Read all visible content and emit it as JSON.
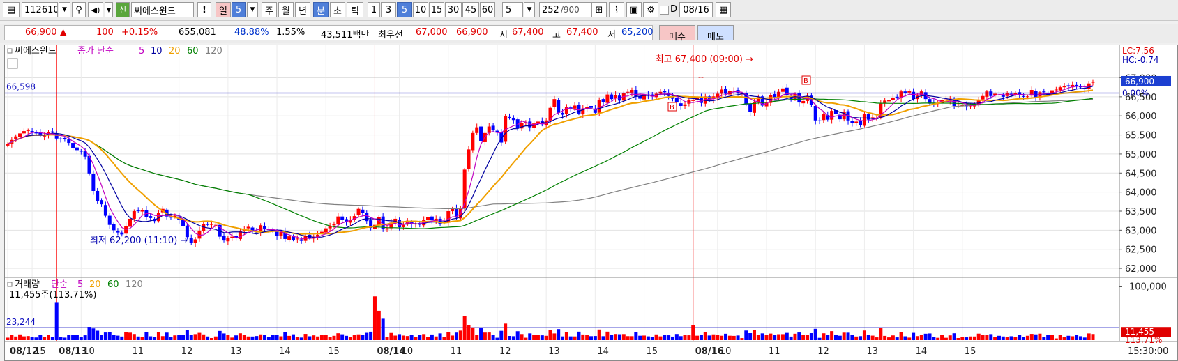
{
  "toolbar": {
    "code": "112610",
    "badge": "신",
    "name": "씨에스윈드",
    "exclaim": "!",
    "period_day": "일",
    "period_num": "5",
    "week": "주",
    "month": "월",
    "year": "년",
    "minute": "분",
    "second": "초",
    "tick": "틱",
    "intervals": [
      "1",
      "3",
      "5",
      "10",
      "15",
      "30",
      "45",
      "60"
    ],
    "selected_interval": "5",
    "interval_value": "5",
    "count": "252",
    "count_max": "/900",
    "d_label": "D",
    "date": "08/16"
  },
  "quote": {
    "price": "66,900 ▲",
    "change": "100",
    "change_pct": "+0.15%",
    "volume": "655,081",
    "vol_ratio": "48.88%",
    "turnover_pct": "1.55%",
    "amount": "43,511백만",
    "best_label": "최우선",
    "ask": "67,000",
    "bid": "66,900",
    "open_label": "시",
    "open": "67,400",
    "high_label": "고",
    "high": "67,400",
    "low_label": "저",
    "low": "65,200",
    "buy": "매수",
    "sell": "매도"
  },
  "colors": {
    "up": "#ff0000",
    "down": "#0000ff",
    "ma5": "#c000c0",
    "ma10": "#0000a0",
    "ma20": "#f0a000",
    "ma60": "#008000",
    "ma120": "#808080",
    "hline": "#1010c0",
    "vline": "#ff0000"
  },
  "legend": {
    "price": {
      "name": "씨에스윈드",
      "kind": "종가 단순",
      "ma": [
        "5",
        "10",
        "20",
        "60",
        "120"
      ]
    },
    "volume": {
      "name": "거래량",
      "kind": "단순",
      "ma": [
        "5",
        "20",
        "60",
        "120"
      ]
    }
  },
  "labels": {
    "hline_price": "66,598",
    "hline_volume": "23,244",
    "volume_info": "11,455주(113.71%)",
    "high_note": "최고 67,400 (09:00) →",
    "low_note": "최저 62,200 (11:10) →",
    "lc": "LC:7.56",
    "hc": "HC:-0.74",
    "price_box": "66,900",
    "pct_box": "0.00%",
    "vol_box": "11,455",
    "vol_pct_box": "113.71%",
    "vol_tick": "100,000",
    "time_corner": "15:30:00",
    "b_marker": "B",
    "dash": "--"
  },
  "x_axis": [
    {
      "label": "08/12",
      "bold": true
    },
    {
      "label": "15"
    },
    {
      "label": "08/13",
      "bold": true
    },
    {
      "label": "10"
    },
    {
      "label": "11"
    },
    {
      "label": "12"
    },
    {
      "label": "13"
    },
    {
      "label": "14"
    },
    {
      "label": "15"
    },
    {
      "label": "08/14",
      "bold": true
    },
    {
      "label": "10"
    },
    {
      "label": "11"
    },
    {
      "label": "12"
    },
    {
      "label": "13"
    },
    {
      "label": "14"
    },
    {
      "label": "15"
    },
    {
      "label": "08/16",
      "bold": true
    },
    {
      "label": "10"
    },
    {
      "label": "11"
    },
    {
      "label": "12"
    },
    {
      "label": "13"
    },
    {
      "label": "14"
    },
    {
      "label": "15"
    }
  ],
  "chart_data": {
    "type": "candlestick",
    "title": "",
    "interval": "5분",
    "y_ticks": [
      "67,000",
      "66,500",
      "66,000",
      "65,500",
      "65,000",
      "64,500",
      "64,000",
      "63,500",
      "63,000",
      "62,500",
      "62,000"
    ],
    "ylim": [
      61800,
      67850
    ],
    "bars_per_session": 78,
    "sessions": [
      "08/12 (last part)",
      "08/13",
      "08/14",
      "08/16"
    ],
    "closes": [
      65260,
      65368,
      65461,
      65540,
      65600,
      65621,
      65578,
      65540,
      65480,
      65490,
      65570,
      65560,
      65405,
      65400,
      65400,
      65290,
      65150,
      65101,
      65070,
      64930,
      64490,
      64030,
      63770,
      63680,
      63380,
      63140,
      63000,
      62940,
      62890,
      63110,
      63300,
      63500,
      63510,
      63530,
      63350,
      63320,
      63240,
      63450,
      63560,
      63360,
      63330,
      63380,
      63270,
      63100,
      62820,
      62660,
      62760,
      62990,
      63160,
      63140,
      63160,
      63140,
      62830,
      62730,
      62800,
      62830,
      62790,
      62980,
      63030,
      63090,
      62980,
      62940,
      63130,
      63030,
      63000,
      62980,
      62860,
      62950,
      62770,
      62840,
      62750,
      62780,
      62720,
      62860,
      62800,
      62830,
      62880,
      62960,
      63050,
      63110,
      63170,
      63360,
      63270,
      63220,
      63280,
      63370,
      63560,
      63460,
      63240,
      63060,
      63140,
      63340,
      63040,
      63050,
      63200,
      63300,
      63080,
      63140,
      63250,
      63160,
      63170,
      63150,
      63270,
      63340,
      63260,
      63300,
      63170,
      63220,
      63500,
      63560,
      63330,
      63580,
      64590,
      65120,
      65550,
      65700,
      65330,
      65550,
      65720,
      65630,
      65580,
      65300,
      65990,
      65950,
      65890,
      65690,
      65810,
      65830,
      65700,
      65800,
      65850,
      65780,
      65880,
      66210,
      66440,
      66080,
      66030,
      66240,
      66190,
      66270,
      66060,
      66190,
      66240,
      66210,
      66080,
      66420,
      66360,
      66560,
      66440,
      66550,
      66400,
      66590,
      66630,
      66680,
      66500,
      66450,
      66560,
      66540,
      66510,
      66580,
      66630,
      66620,
      66520,
      66450,
      66350,
      66260,
      66300,
      66410,
      66420,
      66470,
      66340,
      66510,
      66420,
      66510,
      66580,
      66690,
      66580,
      66650,
      66660,
      66600,
      66590,
      66300,
      66100,
      66370,
      66490,
      66270,
      66340,
      66550,
      66490,
      66630,
      66720,
      66540,
      66440,
      66580,
      66350,
      66390,
      66510,
      66280,
      65880,
      65870,
      66040,
      65900,
      66130,
      66050,
      65910,
      66100,
      65880,
      65810,
      65850,
      65760,
      66040,
      65900,
      65960,
      65950,
      66320,
      66400,
      66420,
      66480,
      66480,
      66640,
      66590,
      66650,
      66440,
      66530,
      66640,
      66440,
      66320,
      66330,
      66330,
      66410,
      66430,
      66450,
      66260,
      66300,
      66280,
      66250,
      66270,
      66300,
      66410,
      66520,
      66640,
      66520,
      66580,
      66540,
      66500,
      66600,
      66550,
      66600,
      66540,
      66500,
      66510,
      66680,
      66480,
      66620,
      66620,
      66550,
      66670,
      66690,
      66750,
      66780,
      66770,
      66810,
      66770,
      66750,
      66700,
      66850,
      66900
    ],
    "daily_summary": {
      "open": "67,400",
      "high": "67,400",
      "low": "65,200",
      "close": "66,900",
      "high_time": "09:00"
    },
    "session_low": {
      "value": 62200,
      "time": "11:10"
    },
    "reference_line": 66598,
    "volume_reference_line": 23244,
    "last_volume": 11455
  }
}
